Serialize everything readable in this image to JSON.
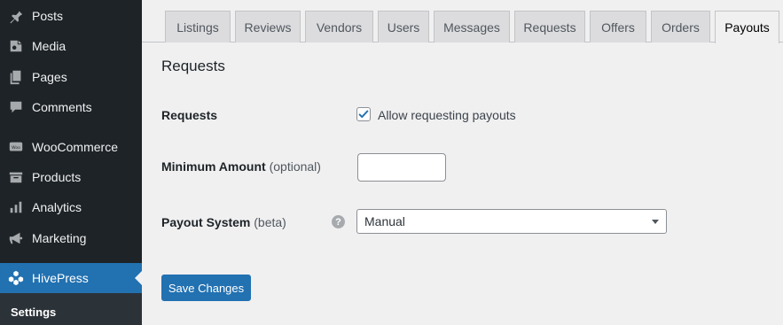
{
  "sidebar": {
    "items": [
      {
        "label": "Posts",
        "icon": "pushpin-icon"
      },
      {
        "label": "Media",
        "icon": "media-icon"
      },
      {
        "label": "Pages",
        "icon": "pages-icon"
      },
      {
        "label": "Comments",
        "icon": "comment-icon"
      },
      {
        "label": "WooCommerce",
        "icon": "woocommerce-icon"
      },
      {
        "label": "Products",
        "icon": "archive-icon"
      },
      {
        "label": "Analytics",
        "icon": "bar-chart-icon"
      },
      {
        "label": "Marketing",
        "icon": "megaphone-icon"
      },
      {
        "label": "HivePress",
        "icon": "hivepress-icon"
      }
    ],
    "submenu": {
      "label": "Settings"
    },
    "active_color": "#2271b1"
  },
  "tabs": [
    {
      "label": "Listings"
    },
    {
      "label": "Reviews"
    },
    {
      "label": "Vendors"
    },
    {
      "label": "Users"
    },
    {
      "label": "Messages"
    },
    {
      "label": "Requests"
    },
    {
      "label": "Offers"
    },
    {
      "label": "Orders"
    },
    {
      "label": "Payouts",
      "active": true
    }
  ],
  "section": {
    "title": "Requests"
  },
  "fields": {
    "requests": {
      "label": "Requests",
      "checkbox_label": "Allow requesting payouts",
      "checked": true
    },
    "minimum_amount": {
      "label": "Minimum Amount",
      "note": "(optional)",
      "value": ""
    },
    "payout_system": {
      "label": "Payout System",
      "note": "(beta)",
      "help": "?",
      "selected": "Manual"
    }
  },
  "buttons": {
    "save": "Save Changes"
  }
}
